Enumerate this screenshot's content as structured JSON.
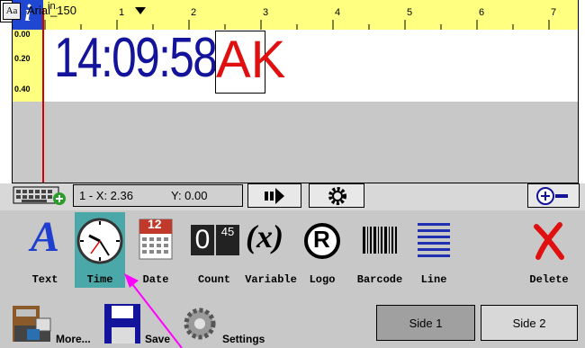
{
  "ruler": {
    "unit": "in.",
    "ticks": [
      "1",
      "2",
      "3",
      "4",
      "5",
      "6",
      "7"
    ],
    "vertical": [
      "0.00",
      "0.20",
      "0.40"
    ]
  },
  "canvas": {
    "time_text": "14:09:58",
    "ak_text": "AK",
    "text_color": "#13139c",
    "ak_color": "#e01010"
  },
  "toolbar": {
    "position_line": "1 - X: 2.36",
    "y_value": "Y: 0.00",
    "font_name": "Arial_150",
    "font_icon": "Aa"
  },
  "tools": [
    {
      "label": "Text"
    },
    {
      "label": "Time"
    },
    {
      "label": "Date"
    },
    {
      "label": "Count"
    },
    {
      "label": "Variable"
    },
    {
      "label": "Logo"
    },
    {
      "label": "Barcode"
    },
    {
      "label": "Line"
    },
    {
      "label": "Delete"
    }
  ],
  "icons": {
    "date_number": "12",
    "count_digits": "0",
    "count_sub": "45",
    "variable_symbol": "(x)",
    "logo_symbol": "R",
    "text_symbol": "A"
  },
  "bottom": {
    "more": "More...",
    "save": "Save",
    "settings": "Settings",
    "side1": "Side 1",
    "side2": "Side 2"
  },
  "colors": {
    "ruler": "#ffff80",
    "selected_tool": "#4aa8a8",
    "arrow": "#ff00ff"
  }
}
